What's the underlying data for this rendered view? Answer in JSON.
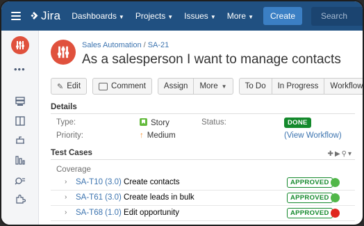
{
  "nav": {
    "app_name": "Jira",
    "items": [
      "Dashboards",
      "Projects",
      "Issues",
      "More"
    ],
    "create_label": "Create",
    "search_placeholder": "Search"
  },
  "sidebar": {
    "more_label": "•••",
    "icons": [
      "board-icon",
      "backlog-icon",
      "releases-icon",
      "reports-icon",
      "search-tests-icon",
      "addons-icon"
    ]
  },
  "issue": {
    "project": "Sales Automation",
    "key": "SA-21",
    "summary": "As a salesperson I want to manage contacts"
  },
  "toolbar": {
    "edit": "Edit",
    "comment": "Comment",
    "assign": "Assign",
    "more": "More",
    "todo": "To Do",
    "in_progress": "In Progress",
    "workflow": "Workflow"
  },
  "details": {
    "heading": "Details",
    "type_label": "Type:",
    "type_value": "Story",
    "status_label": "Status:",
    "status_value": "DONE",
    "priority_label": "Priority:",
    "priority_value": "Medium",
    "view_workflow": "(View Workflow)"
  },
  "test_cases": {
    "heading": "Test Cases",
    "tools": "+ ▶ 🔍 ▾",
    "group": "Coverage",
    "rows": [
      {
        "key": "SA-T10 (3.0)",
        "title": "Create contacts",
        "status": "APPROVED",
        "result_color": "#51b749"
      },
      {
        "key": "SA-T61 (3.0)",
        "title": "Create leads in bulk",
        "status": "APPROVED",
        "result_color": "#51b749"
      },
      {
        "key": "SA-T68 (1.0)",
        "title": "Edit opportunity",
        "status": "APPROVED",
        "result_color": "#e0271e"
      }
    ]
  },
  "colors": {
    "nav_bg": "#205081",
    "accent": "#3b7fc4",
    "done": "#14892c",
    "avatar": "#e0513d"
  }
}
